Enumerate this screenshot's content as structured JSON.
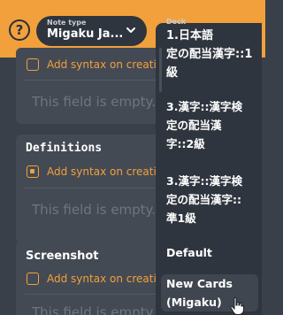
{
  "header": {
    "help_icon_glyph": "?",
    "note_type": {
      "label": "Note type",
      "value": "Migaku Ja..."
    },
    "deck": {
      "label": "Deck"
    }
  },
  "fields": [
    {
      "title": "",
      "syntax_label": "Add syntax on creati",
      "empty_text": "This field is empty...",
      "checked": false
    },
    {
      "title": "Definitions",
      "syntax_label": "Add syntax on creati",
      "empty_text": "This field is empty...",
      "checked": true
    },
    {
      "title": "Screenshot",
      "syntax_label": "Add syntax on creati",
      "empty_text": "This field is empty...",
      "checked": false
    }
  ],
  "deck_options": [
    {
      "label": "1.日本語\n定の配当漢字::1\n級"
    },
    {
      "label": "3.漢字::漢字検\n定の配当漢\n字::2級"
    },
    {
      "label": "3.漢字::漢字検\n定の配当漢字::\n準1級"
    },
    {
      "label": "Default"
    },
    {
      "label": "New Cards\n(Migaku)"
    }
  ],
  "colors": {
    "accent": "#f2a03c",
    "background": "#3a4049",
    "panel": "#444a54",
    "dropdown": "#2f353e"
  }
}
